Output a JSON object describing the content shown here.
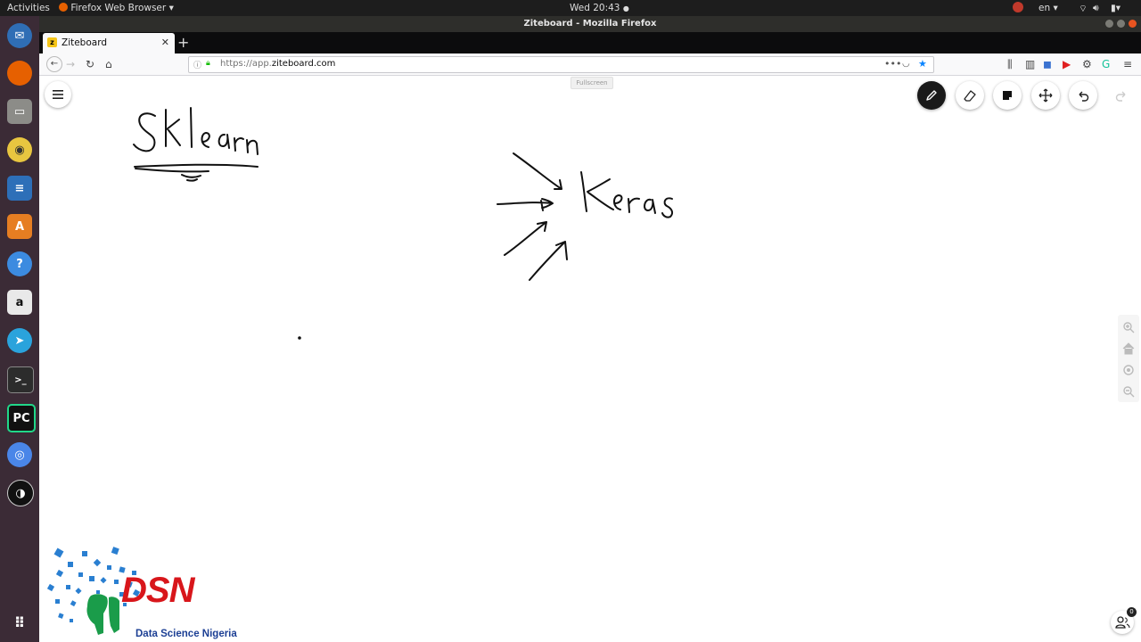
{
  "top_bar": {
    "activities": "Activities",
    "app_menu": "Firefox Web Browser",
    "clock": "Wed 20:43",
    "language": "en"
  },
  "window": {
    "title": "Ziteboard - Mozilla Firefox"
  },
  "dock": {
    "items": [
      "thunderbird-icon",
      "firefox-icon",
      "files-icon",
      "rhythmbox-icon",
      "writer-icon",
      "software-icon",
      "help-icon",
      "amazon-icon",
      "telegram-icon",
      "terminal-icon",
      "pycharm-icon",
      "chromium-icon",
      "obs-icon",
      "show-apps-icon"
    ],
    "pycharm_label": "PC"
  },
  "browser": {
    "tab_title": "Ziteboard",
    "url_prefix": "https://app.",
    "url_domain": "ziteboard.com"
  },
  "board": {
    "fullscreen_label": "Fullscreen",
    "handwriting": [
      "Sklearn",
      "Keras"
    ],
    "active_tool": "pen",
    "users_count": "0",
    "logo_text": "DSN",
    "logo_subtitle": "Data Science Nigeria"
  },
  "colors": {
    "dock_bg": "#3b2b36",
    "topbar_bg": "#1d1d1d",
    "logo_red": "#d8161b",
    "logo_blue": "#1c3f94"
  }
}
